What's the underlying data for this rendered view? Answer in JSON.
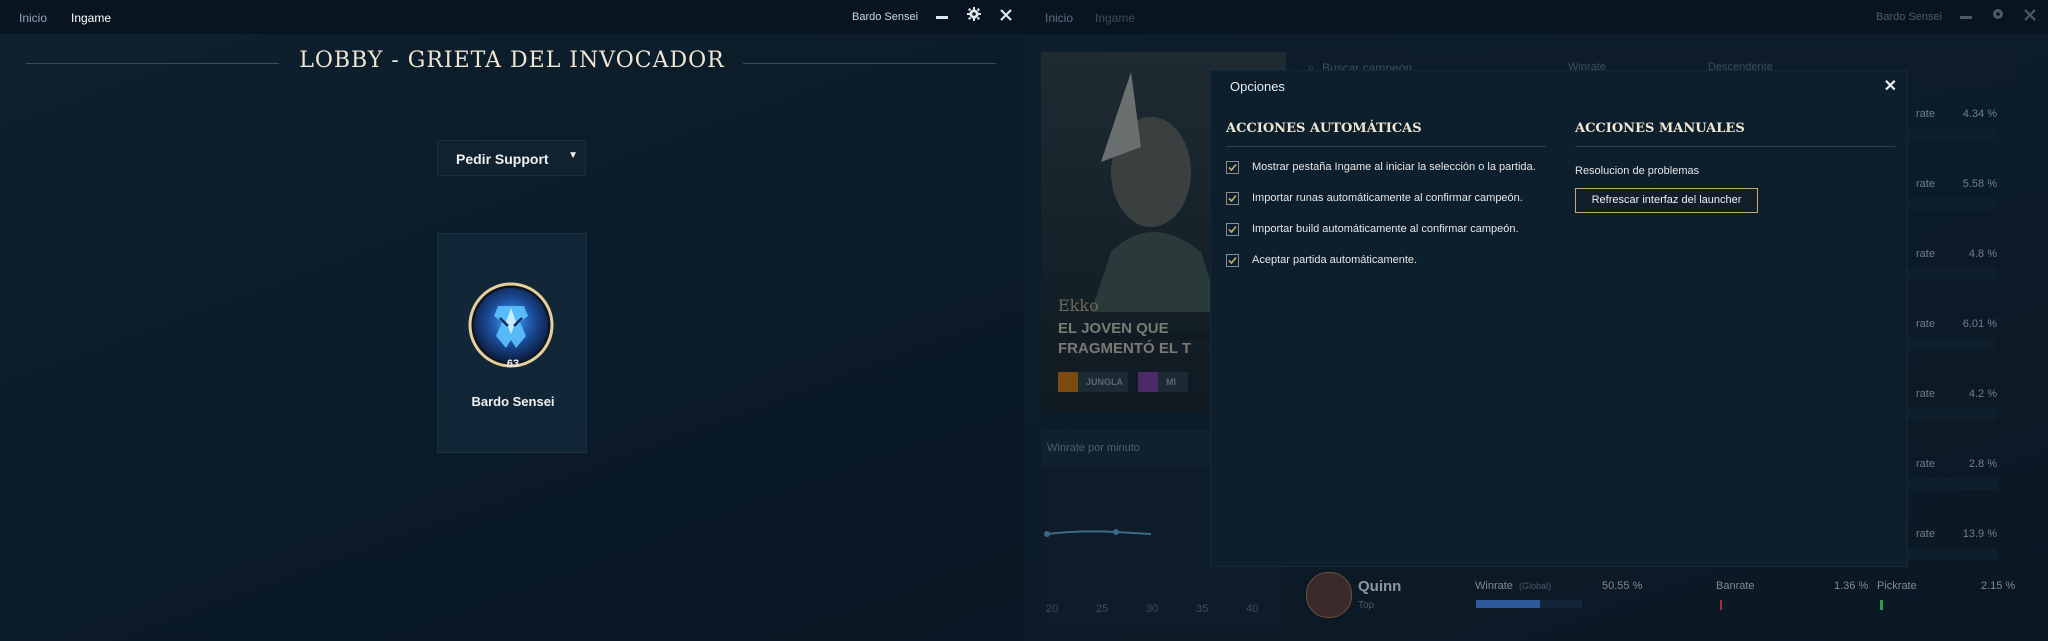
{
  "left": {
    "nav": {
      "home": "Inicio",
      "ingame": "Ingame"
    },
    "user": "Bardo Sensei",
    "lobby_title": "LOBBY - GRIETA DEL INVOCADOR",
    "role_select": {
      "value": "Pedir Support"
    },
    "card": {
      "level": "63",
      "name": "Bardo Sensei"
    },
    "colors": {
      "accent_gold": "#c8aa6e",
      "title": "#f0e6d2"
    }
  },
  "right": {
    "nav": {
      "home": "Inicio",
      "ingame": "Ingame"
    },
    "user": "Bardo Sensei",
    "background": {
      "search_placeholder": "Buscar campeón",
      "sort_field": "Winrate",
      "sort_order": "Descendente",
      "champion": {
        "name": "Ekko",
        "subtitle_1": "EL JOVEN QUE",
        "subtitle_2": "FRAGMENTÓ EL T",
        "role_1": "JUNGLA",
        "role_2": "MI"
      },
      "chart_title": "Winrate por minuto",
      "chart_ticks": [
        "20",
        "25",
        "30",
        "35",
        "40"
      ],
      "rows": [
        {
          "label": "rate",
          "pct": "4.34 %"
        },
        {
          "label": "rate",
          "pct": "5.58 %"
        },
        {
          "label": "rate",
          "pct": "4.8 %"
        },
        {
          "label": "rate",
          "pct": "6.01 %"
        },
        {
          "label": "rate",
          "pct": "4.2 %"
        },
        {
          "label": "rate",
          "pct": "2.8 %"
        },
        {
          "label": "rate",
          "pct": "13.9 %"
        }
      ],
      "quinn": {
        "name": "Quinn",
        "role": "Top",
        "winrate_label": "Winrate",
        "winrate_scope": "(Global)",
        "winrate": "50.55 %",
        "banrate_label": "Banrate",
        "banrate": "1.36 %",
        "pickrate_label": "Pickrate",
        "pickrate": "2.15 %"
      }
    },
    "modal": {
      "title": "Opciones",
      "auto_title": "ACCIONES AUTOMÁTICAS",
      "manual_title": "ACCIONES MANUALES",
      "options": [
        {
          "label": "Mostrar pestaña Ingame al iniciar la selección o la partida.",
          "checked": true
        },
        {
          "label": "Importar runas automáticamente al confirmar campeón.",
          "checked": true
        },
        {
          "label": "Importar build automáticamente al confirmar campeón.",
          "checked": true
        },
        {
          "label": "Aceptar partida automáticamente.",
          "checked": true
        }
      ],
      "troubleshoot_label": "Resolucion de problemas",
      "refresh_button": "Refrescar interfaz del launcher"
    }
  }
}
